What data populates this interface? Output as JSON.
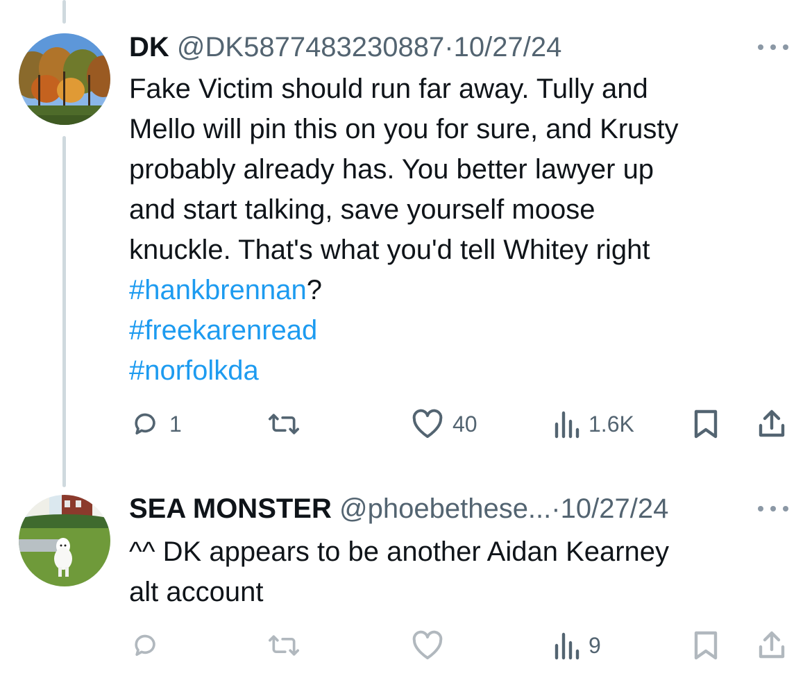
{
  "tweet1": {
    "name": "DK",
    "handle": "@DK5877483230887",
    "separator": "·",
    "date": "10/27/24",
    "lines": [
      "Fake Victim should run far away.  Tully and",
      "Mello will pin this on you for sure, and Krusty",
      "probably already has.  You better lawyer up",
      "and start talking, save yourself moose",
      "knuckle.  That's what you'd tell Whitey right"
    ],
    "hashtag1": "#hankbrennan",
    "hashtag1_suffix": "?",
    "hashtag2": "#freekarenread",
    "hashtag3": "#norfolkda",
    "replies": "1",
    "likes": "40",
    "views": "1.6K",
    "avatar_icon": "autumn-trees-avatar"
  },
  "tweet2": {
    "name": "SEA MONSTER",
    "handle": "@phoebethese...",
    "separator": "·",
    "date": "10/27/24",
    "line1": "^^ DK appears to be another Aidan Kearney",
    "line2": "alt account",
    "views": "9",
    "avatar_icon": "white-dog-avatar"
  },
  "icons": [
    "reply-icon",
    "retweet-icon",
    "like-icon",
    "views-icon",
    "bookmark-icon",
    "share-icon",
    "more-icon"
  ],
  "colors": {
    "text": "#0f1419",
    "secondary": "#536471",
    "hashtag": "#1d9bf0",
    "thread_line": "#cfd9de"
  }
}
